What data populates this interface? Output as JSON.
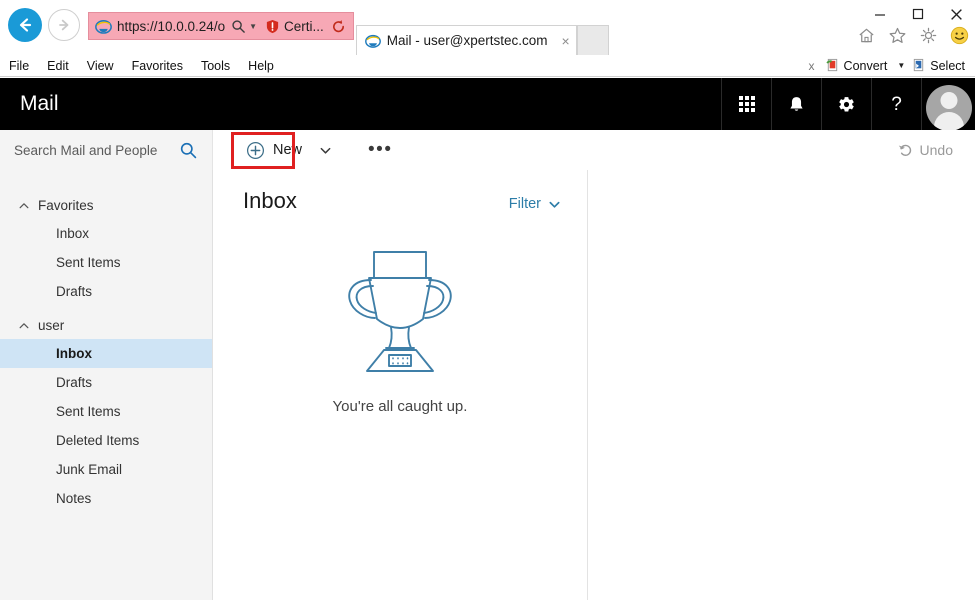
{
  "browser": {
    "back_icon": "back-arrow-icon",
    "forward_icon": "forward-arrow-icon",
    "address": {
      "favicon": "ie-logo-icon",
      "url": "https://10.0.0.24/o",
      "search_icon": "search-icon",
      "dropdown_icon": "chevron-down-icon",
      "certificate_icon": "certificate-error-shield-icon",
      "certificate_label": "Certi...",
      "refresh_icon": "refresh-icon"
    },
    "tabs": [
      {
        "favicon": "ie-logo-icon",
        "title": "Mail - user@xpertstec.com",
        "close": "×",
        "active": true
      }
    ],
    "new_tab_label": "",
    "window_controls": {
      "minimize": "–",
      "maximize": "□",
      "close": "✕"
    },
    "command_icons": [
      "home-icon",
      "favorites-star-icon",
      "tools-gear-icon",
      "smiley-feedback-icon"
    ],
    "menubar": [
      "File",
      "Edit",
      "View",
      "Favorites",
      "Tools",
      "Help"
    ],
    "adobe_toolbar": {
      "close_label": "x",
      "convert_label": "Convert",
      "convert_caret": "chevron-down-icon",
      "select_label": "Select"
    }
  },
  "owa": {
    "header": {
      "brand": "Mail",
      "buttons": [
        {
          "name": "app-launcher-icon",
          "label": ""
        },
        {
          "name": "notifications-bell-icon",
          "label": ""
        },
        {
          "name": "settings-gear-icon",
          "label": ""
        },
        {
          "name": "help-question-icon",
          "label": "?"
        }
      ],
      "avatar": "user-avatar"
    },
    "search": {
      "placeholder": "Search Mail and People",
      "icon": "search-icon"
    },
    "commands": {
      "new_label": "New",
      "new_plus_icon": "plus-circle-icon",
      "new_caret_icon": "chevron-down-icon",
      "more_label": "•••",
      "undo_label": "Undo",
      "undo_icon": "undo-arrow-icon"
    },
    "annotation": {
      "target": "New",
      "color": "#e02020"
    },
    "sidebar": {
      "groups": [
        {
          "name": "Favorites",
          "label": "Favorites",
          "expanded": true,
          "chevron": "chevron-up-icon",
          "items": [
            {
              "label": "Inbox",
              "selected": false
            },
            {
              "label": "Sent Items",
              "selected": false
            },
            {
              "label": "Drafts",
              "selected": false
            }
          ]
        },
        {
          "name": "user",
          "label": "user",
          "expanded": true,
          "chevron": "chevron-up-icon",
          "items": [
            {
              "label": "Inbox",
              "selected": true
            },
            {
              "label": "Drafts",
              "selected": false
            },
            {
              "label": "Sent Items",
              "selected": false
            },
            {
              "label": "Deleted Items",
              "selected": false
            },
            {
              "label": "Junk Email",
              "selected": false
            },
            {
              "label": "Notes",
              "selected": false
            }
          ]
        }
      ]
    },
    "list": {
      "title": "Inbox",
      "filter_label": "Filter",
      "filter_caret": "chevron-down-icon",
      "empty_illustration": "trophy-icon",
      "empty_message": "You're all caught up."
    }
  },
  "colors": {
    "owa_header_bg": "#000000",
    "sidebar_bg": "#f4f4f4",
    "selected_item_bg": "#cfe4f5",
    "accent_link": "#2d7da8",
    "annotation_red": "#e02020",
    "address_error_bg": "#f7a8b5",
    "trophy_stroke": "#3f7fa8"
  }
}
